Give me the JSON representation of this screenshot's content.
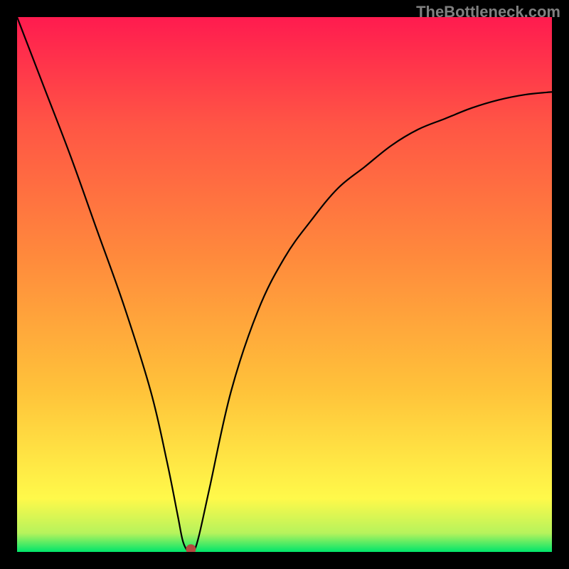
{
  "watermark": "TheBottleneck.com",
  "chart_data": {
    "type": "line",
    "title": "",
    "xlabel": "",
    "ylabel": "",
    "xlim": [
      0,
      100
    ],
    "ylim": [
      0,
      100
    ],
    "grid": false,
    "background_gradient": [
      "#00e56b",
      "#b6f35c",
      "#fff94a",
      "#ffc33a",
      "#ff8a3c",
      "#ff5545",
      "#ff1b4f"
    ],
    "series": [
      {
        "name": "bottleneck-curve",
        "x": [
          0,
          5,
          10,
          15,
          20,
          25,
          28,
          30,
          31,
          32,
          32.5,
          33,
          34,
          36,
          40,
          45,
          50,
          55,
          60,
          65,
          70,
          75,
          80,
          85,
          90,
          95,
          100
        ],
        "y": [
          100,
          87,
          74,
          60,
          46,
          30,
          17,
          7,
          2,
          0,
          0,
          0,
          3,
          12,
          30,
          45,
          55,
          62,
          68,
          72,
          76,
          79,
          81,
          83,
          84.5,
          85.5,
          86
        ]
      }
    ],
    "marker": {
      "x": 32.5,
      "y": 0.5,
      "color": "#b5483e"
    },
    "annotations": []
  },
  "colors": {
    "frame": "#000000",
    "curve": "#000000",
    "marker": "#b5483e"
  }
}
